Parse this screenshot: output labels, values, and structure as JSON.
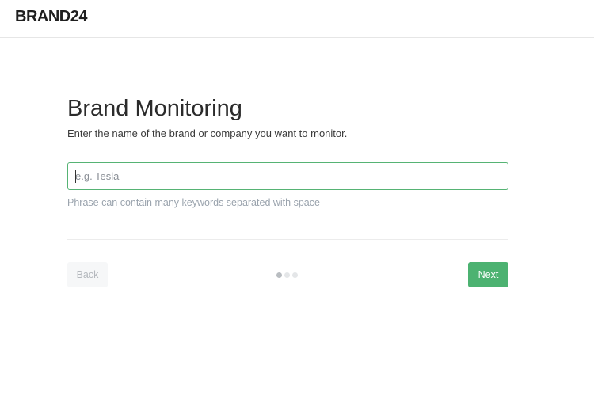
{
  "header": {
    "logo_text": "BRAND24"
  },
  "main": {
    "title": "Brand Monitoring",
    "subtitle": "Enter the name of the brand or company you want to monitor.",
    "input": {
      "value": "",
      "placeholder": "e.g. Tesla"
    },
    "hint": "Phrase can contain many keywords separated with space"
  },
  "footer": {
    "back_label": "Back",
    "next_label": "Next",
    "steps": {
      "total": 3,
      "current": 1
    }
  },
  "colors": {
    "accent": "#4cb271",
    "input_border": "#56b374",
    "hint": "#9aa3ad"
  }
}
